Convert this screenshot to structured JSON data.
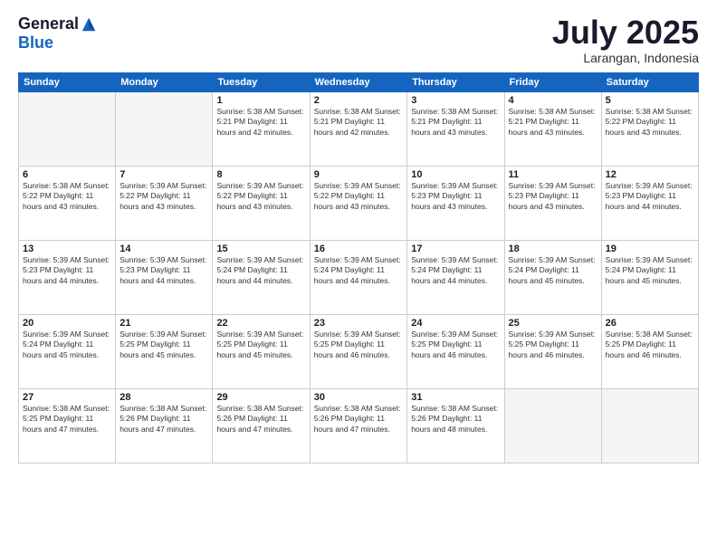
{
  "logo": {
    "general": "General",
    "blue": "Blue"
  },
  "title": "July 2025",
  "location": "Larangan, Indonesia",
  "weekdays": [
    "Sunday",
    "Monday",
    "Tuesday",
    "Wednesday",
    "Thursday",
    "Friday",
    "Saturday"
  ],
  "weeks": [
    [
      {
        "day": "",
        "info": ""
      },
      {
        "day": "",
        "info": ""
      },
      {
        "day": "1",
        "info": "Sunrise: 5:38 AM\nSunset: 5:21 PM\nDaylight: 11 hours\nand 42 minutes."
      },
      {
        "day": "2",
        "info": "Sunrise: 5:38 AM\nSunset: 5:21 PM\nDaylight: 11 hours\nand 42 minutes."
      },
      {
        "day": "3",
        "info": "Sunrise: 5:38 AM\nSunset: 5:21 PM\nDaylight: 11 hours\nand 43 minutes."
      },
      {
        "day": "4",
        "info": "Sunrise: 5:38 AM\nSunset: 5:21 PM\nDaylight: 11 hours\nand 43 minutes."
      },
      {
        "day": "5",
        "info": "Sunrise: 5:38 AM\nSunset: 5:22 PM\nDaylight: 11 hours\nand 43 minutes."
      }
    ],
    [
      {
        "day": "6",
        "info": "Sunrise: 5:38 AM\nSunset: 5:22 PM\nDaylight: 11 hours\nand 43 minutes."
      },
      {
        "day": "7",
        "info": "Sunrise: 5:39 AM\nSunset: 5:22 PM\nDaylight: 11 hours\nand 43 minutes."
      },
      {
        "day": "8",
        "info": "Sunrise: 5:39 AM\nSunset: 5:22 PM\nDaylight: 11 hours\nand 43 minutes."
      },
      {
        "day": "9",
        "info": "Sunrise: 5:39 AM\nSunset: 5:22 PM\nDaylight: 11 hours\nand 43 minutes."
      },
      {
        "day": "10",
        "info": "Sunrise: 5:39 AM\nSunset: 5:23 PM\nDaylight: 11 hours\nand 43 minutes."
      },
      {
        "day": "11",
        "info": "Sunrise: 5:39 AM\nSunset: 5:23 PM\nDaylight: 11 hours\nand 43 minutes."
      },
      {
        "day": "12",
        "info": "Sunrise: 5:39 AM\nSunset: 5:23 PM\nDaylight: 11 hours\nand 44 minutes."
      }
    ],
    [
      {
        "day": "13",
        "info": "Sunrise: 5:39 AM\nSunset: 5:23 PM\nDaylight: 11 hours\nand 44 minutes."
      },
      {
        "day": "14",
        "info": "Sunrise: 5:39 AM\nSunset: 5:23 PM\nDaylight: 11 hours\nand 44 minutes."
      },
      {
        "day": "15",
        "info": "Sunrise: 5:39 AM\nSunset: 5:24 PM\nDaylight: 11 hours\nand 44 minutes."
      },
      {
        "day": "16",
        "info": "Sunrise: 5:39 AM\nSunset: 5:24 PM\nDaylight: 11 hours\nand 44 minutes."
      },
      {
        "day": "17",
        "info": "Sunrise: 5:39 AM\nSunset: 5:24 PM\nDaylight: 11 hours\nand 44 minutes."
      },
      {
        "day": "18",
        "info": "Sunrise: 5:39 AM\nSunset: 5:24 PM\nDaylight: 11 hours\nand 45 minutes."
      },
      {
        "day": "19",
        "info": "Sunrise: 5:39 AM\nSunset: 5:24 PM\nDaylight: 11 hours\nand 45 minutes."
      }
    ],
    [
      {
        "day": "20",
        "info": "Sunrise: 5:39 AM\nSunset: 5:24 PM\nDaylight: 11 hours\nand 45 minutes."
      },
      {
        "day": "21",
        "info": "Sunrise: 5:39 AM\nSunset: 5:25 PM\nDaylight: 11 hours\nand 45 minutes."
      },
      {
        "day": "22",
        "info": "Sunrise: 5:39 AM\nSunset: 5:25 PM\nDaylight: 11 hours\nand 45 minutes."
      },
      {
        "day": "23",
        "info": "Sunrise: 5:39 AM\nSunset: 5:25 PM\nDaylight: 11 hours\nand 46 minutes."
      },
      {
        "day": "24",
        "info": "Sunrise: 5:39 AM\nSunset: 5:25 PM\nDaylight: 11 hours\nand 46 minutes."
      },
      {
        "day": "25",
        "info": "Sunrise: 5:39 AM\nSunset: 5:25 PM\nDaylight: 11 hours\nand 46 minutes."
      },
      {
        "day": "26",
        "info": "Sunrise: 5:38 AM\nSunset: 5:25 PM\nDaylight: 11 hours\nand 46 minutes."
      }
    ],
    [
      {
        "day": "27",
        "info": "Sunrise: 5:38 AM\nSunset: 5:25 PM\nDaylight: 11 hours\nand 47 minutes."
      },
      {
        "day": "28",
        "info": "Sunrise: 5:38 AM\nSunset: 5:26 PM\nDaylight: 11 hours\nand 47 minutes."
      },
      {
        "day": "29",
        "info": "Sunrise: 5:38 AM\nSunset: 5:26 PM\nDaylight: 11 hours\nand 47 minutes."
      },
      {
        "day": "30",
        "info": "Sunrise: 5:38 AM\nSunset: 5:26 PM\nDaylight: 11 hours\nand 47 minutes."
      },
      {
        "day": "31",
        "info": "Sunrise: 5:38 AM\nSunset: 5:26 PM\nDaylight: 11 hours\nand 48 minutes."
      },
      {
        "day": "",
        "info": ""
      },
      {
        "day": "",
        "info": ""
      }
    ]
  ]
}
